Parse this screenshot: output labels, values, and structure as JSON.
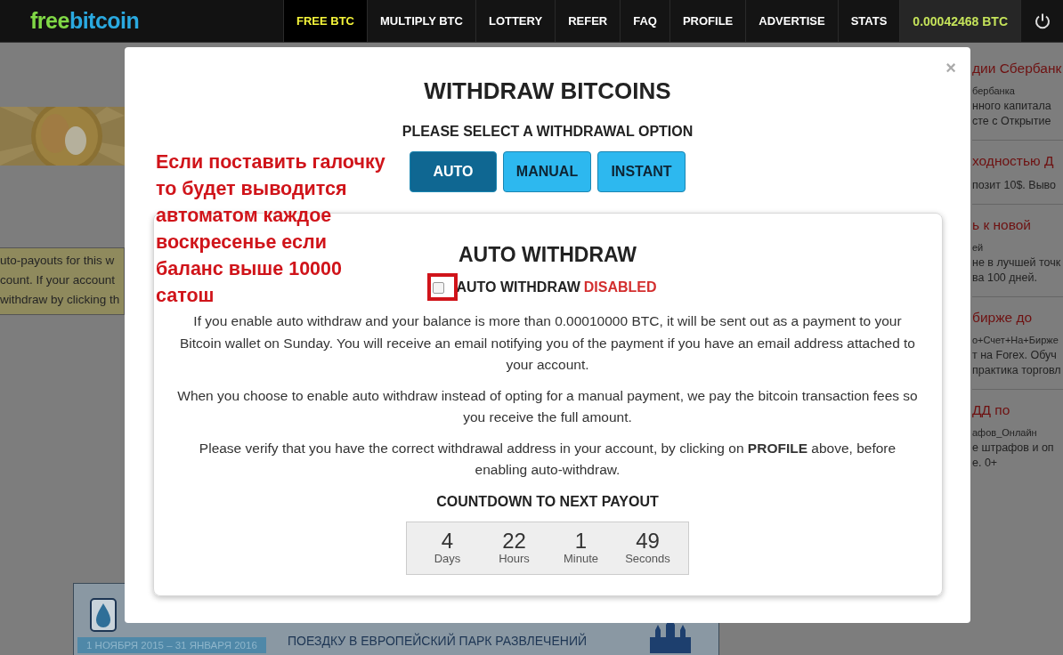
{
  "header": {
    "logo": [
      {
        "text": "free",
        "color": "#80d846"
      },
      {
        "text": "bitcoin",
        "color": "#2aa9e0"
      }
    ],
    "nav": [
      {
        "label": "FREE BTC",
        "selected": true
      },
      {
        "label": "MULTIPLY BTC",
        "selected": false
      },
      {
        "label": "LOTTERY",
        "selected": false
      },
      {
        "label": "REFER",
        "selected": false
      },
      {
        "label": "FAQ",
        "selected": false
      },
      {
        "label": "PROFILE",
        "selected": false
      },
      {
        "label": "ADVERTISE",
        "selected": false
      },
      {
        "label": "STATS",
        "selected": false
      }
    ],
    "balance": "0.00042468 BTC"
  },
  "background": {
    "left_notice": [
      "uto-payouts for this w",
      "count. If your account",
      "withdraw by clicking th"
    ],
    "right_ads": [
      {
        "title": "дии Сбербанк",
        "source": "бербанка",
        "lines": [
          "нного капитала",
          "сте с Открытие"
        ]
      },
      {
        "title": "ходностью Д",
        "lines": [
          "позит 10$. Выво"
        ]
      },
      {
        "title": "ь к новой",
        "source": "ей",
        "lines": [
          "не в лучшей точк",
          "ва 100 дней."
        ]
      },
      {
        "title": "бирже до",
        "source": "о+Счет+На+Бирже",
        "lines": [
          "т на Forex. Обуч",
          "практика торговл"
        ]
      },
      {
        "title": "ДД по",
        "source": "афов_Онлайн",
        "lines": [
          "е штрафов и оп",
          "е. 0+"
        ]
      }
    ],
    "banner": {
      "dates": "1 НОЯБРЯ 2015 – 31 ЯНВАРЯ 2016",
      "text": "ПОЕЗДКУ В ЕВРОПЕЙСКИЙ ПАРК РАЗВЛЕЧЕНИЙ"
    }
  },
  "modal": {
    "close": "×",
    "title": "WITHDRAW BITCOINS",
    "subtitle": "PLEASE SELECT A WITHDRAWAL OPTION",
    "options": [
      {
        "label": "AUTO",
        "selected": true
      },
      {
        "label": "MANUAL",
        "selected": false
      },
      {
        "label": "INSTANT",
        "selected": false
      }
    ],
    "panel": {
      "title": "AUTO WITHDRAW",
      "checkbox": {
        "label": "AUTO WITHDRAW",
        "status": "DISABLED",
        "checked": false
      },
      "paragraphs": [
        "If you enable auto withdraw and your balance is more than 0.00010000 BTC, it will be sent out as a payment to your Bitcoin wallet on Sunday. You will receive an email notifying you of the payment if you have an email address attached to your account.",
        "When you choose to enable auto withdraw instead of opting for a manual payment, we pay the bitcoin transaction fees so you receive the full amount.",
        "Please verify that you have the correct withdrawal address in your account, by clicking on **PROFILE** above, before enabling auto-withdraw."
      ],
      "countdown_title": "COUNTDOWN TO NEXT PAYOUT",
      "countdown": [
        {
          "value": "4",
          "unit": "Days"
        },
        {
          "value": "22",
          "unit": "Hours"
        },
        {
          "value": "1",
          "unit": "Minute"
        },
        {
          "value": "49",
          "unit": "Seconds"
        }
      ]
    }
  },
  "annotation": {
    "text": "Если поставить галочку\nто будет выводится\nавтоматом каждое\nвоскресенье если\nбаланс выше 10000\nсатош"
  }
}
